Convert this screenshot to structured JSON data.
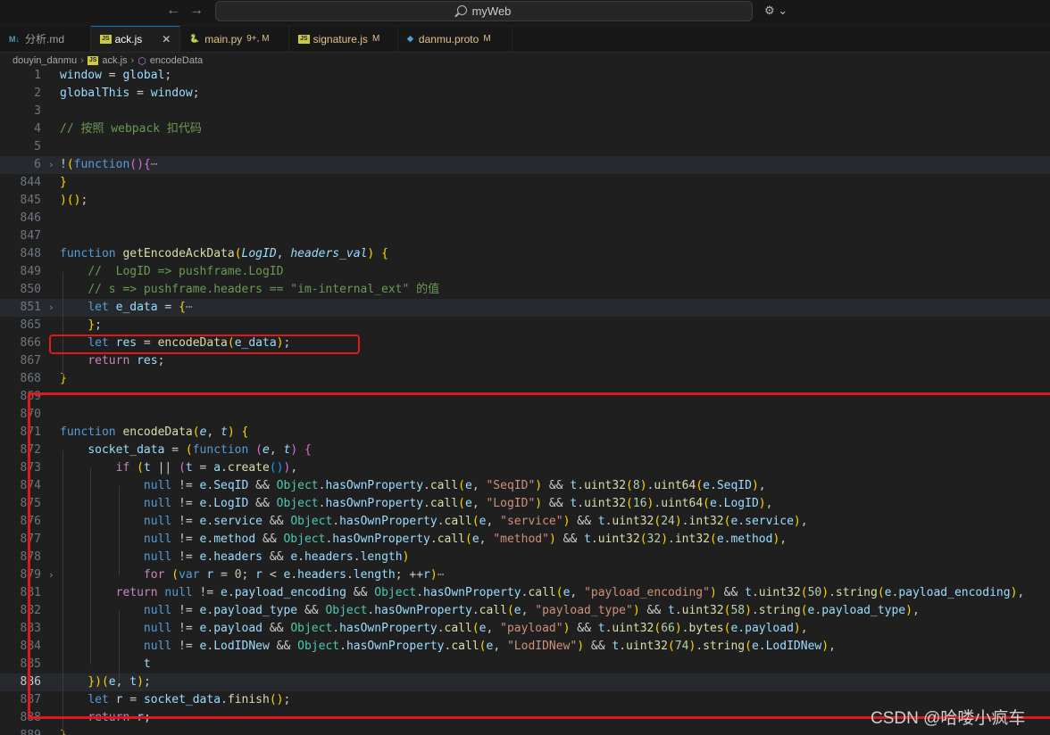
{
  "titlebar": {
    "back_label": "←",
    "forward_label": "→",
    "search_label": "myWeb",
    "account_label": "⚙ ⌄"
  },
  "tabs": [
    {
      "icon_label": "M↓",
      "icon_color": "#519aba",
      "label": "分析.md",
      "badge": ""
    },
    {
      "icon_label": "JS",
      "icon_color": "#cbcb41",
      "label": "ack.js",
      "badge": ""
    },
    {
      "icon_label": "🐍",
      "icon_color": "#3776ab",
      "label": "main.py",
      "badge": "9+, M"
    },
    {
      "icon_label": "JS",
      "icon_color": "#cbcb41",
      "label": "signature.js",
      "badge": "M"
    },
    {
      "icon_label": "◆",
      "icon_color": "#4d9fd6",
      "label": "danmu.proto",
      "badge": "M"
    }
  ],
  "breadcrumb": {
    "folder": "douyin_danmu",
    "file": "ack.js",
    "symbol": "encodeData"
  },
  "code_lines": [
    {
      "n": "1",
      "text": "window = global;"
    },
    {
      "n": "2",
      "text": "globalThis = window;"
    },
    {
      "n": "3",
      "text": ""
    },
    {
      "n": "4",
      "text": "// 按照 webpack 扣代码"
    },
    {
      "n": "5",
      "text": ""
    },
    {
      "n": "6",
      "text": "!(function(){⋯"
    },
    {
      "n": "844",
      "text": "}"
    },
    {
      "n": "845",
      "text": ")();"
    },
    {
      "n": "846",
      "text": ""
    },
    {
      "n": "847",
      "text": ""
    },
    {
      "n": "848",
      "text": "function getEncodeAckData(LogID, headers_val) {"
    },
    {
      "n": "849",
      "text": "    //  LogID => pushframe.LogID"
    },
    {
      "n": "850",
      "text": "    // s => pushframe.headers == \"im-internal_ext\" 的值"
    },
    {
      "n": "851",
      "text": "    let e_data = {⋯"
    },
    {
      "n": "865",
      "text": "    };"
    },
    {
      "n": "866",
      "text": "    let res = encodeData(e_data);"
    },
    {
      "n": "867",
      "text": "    return res;"
    },
    {
      "n": "868",
      "text": "}"
    },
    {
      "n": "869",
      "text": ""
    },
    {
      "n": "870",
      "text": ""
    },
    {
      "n": "871",
      "text": "function encodeData(e, t) {"
    },
    {
      "n": "872",
      "text": "    socket_data = (function (e, t) {"
    },
    {
      "n": "873",
      "text": "        if (t || (t = a.create()),"
    },
    {
      "n": "874",
      "text": "            null != e.SeqID && Object.hasOwnProperty.call(e, \"SeqID\") && t.uint32(8).uint64(e.SeqID),"
    },
    {
      "n": "875",
      "text": "            null != e.LogID && Object.hasOwnProperty.call(e, \"LogID\") && t.uint32(16).uint64(e.LogID),"
    },
    {
      "n": "876",
      "text": "            null != e.service && Object.hasOwnProperty.call(e, \"service\") && t.uint32(24).int32(e.service),"
    },
    {
      "n": "877",
      "text": "            null != e.method && Object.hasOwnProperty.call(e, \"method\") && t.uint32(32).int32(e.method),"
    },
    {
      "n": "878",
      "text": "            null != e.headers && e.headers.length)"
    },
    {
      "n": "879",
      "text": "            for (var r = 0; r < e.headers.length; ++r)⋯"
    },
    {
      "n": "881",
      "text": "        return null != e.payload_encoding && Object.hasOwnProperty.call(e, \"payload_encoding\") && t.uint32(50).string(e.payload_encoding),"
    },
    {
      "n": "882",
      "text": "            null != e.payload_type && Object.hasOwnProperty.call(e, \"payload_type\") && t.uint32(58).string(e.payload_type),"
    },
    {
      "n": "883",
      "text": "            null != e.payload && Object.hasOwnProperty.call(e, \"payload\") && t.uint32(66).bytes(e.payload),"
    },
    {
      "n": "884",
      "text": "            null != e.LodIDNew && Object.hasOwnProperty.call(e, \"LodIDNew\") && t.uint32(74).string(e.LodIDNew),"
    },
    {
      "n": "885",
      "text": "            t"
    },
    {
      "n": "886",
      "text": "    })(e, t);"
    },
    {
      "n": "887",
      "text": "    let r = socket_data.finish();"
    },
    {
      "n": "888",
      "text": "    return r;"
    },
    {
      "n": "889",
      "text": "}"
    }
  ],
  "watermark": "CSDN @哈喽小疯车"
}
